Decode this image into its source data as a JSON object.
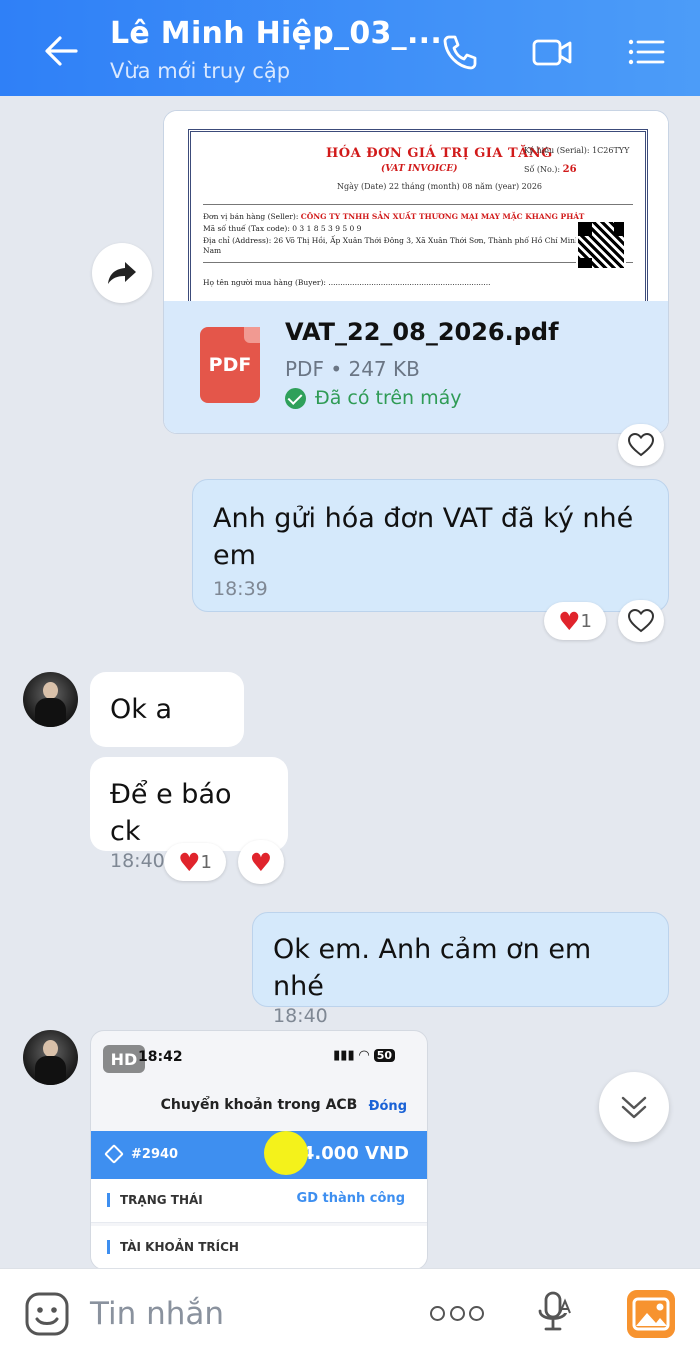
{
  "header": {
    "title": "Lê Minh Hiệp_03_...",
    "subtitle": "Vừa mới truy cập"
  },
  "file_message": {
    "invoice": {
      "title": "HÓA ĐƠN GIÁ TRỊ GIA TĂNG",
      "subtitle": "(VAT INVOICE)",
      "date_line": "Ngày (Date) 22 tháng (month) 08 năm (year) 2026",
      "serial_line": "Ký hiệu (Serial): 1C26TYY",
      "number_label": "Số (No.):",
      "number": "26",
      "seller_label": "Đơn vị bán hàng (Seller):",
      "seller": "CÔNG TY TNHH SẢN XUẤT THƯƠNG MẠI MAY MẶC KHANG PHÁT",
      "tax_line": "Mã số thuế (Tax code): 0 3 1 8 5 3 9 5 0 9",
      "address_line": "Địa chỉ (Address): 26 Võ Thị Hồi, Ấp Xuân Thới Đông 3, Xã Xuân Thới Sơn, Thành phố Hồ Chí Minh, Việt",
      "address_line2": "Nam",
      "buyer_line": "Họ tên người mua hàng (Buyer): ...................................................................."
    },
    "file_icon_label": "PDF",
    "file_name": "VAT_22_08_2026.pdf",
    "file_meta": "PDF • 247 KB",
    "file_status": "Đã có trên máy"
  },
  "messages": [
    {
      "text": "Anh gửi hóa đơn VAT đã ký nhé em",
      "time": "18:39",
      "reaction_count": "1"
    },
    {
      "text": "Ok a"
    },
    {
      "text": "Để e báo ck",
      "time": "18:40",
      "reaction_count": "1"
    },
    {
      "text": "Ok em. Anh cảm ơn em nhé",
      "time": "18:40"
    }
  ],
  "image_message": {
    "hd_badge": "HD",
    "phone_time": "18:42",
    "battery": "50",
    "screen_title": "Chuyển khoản trong ACB",
    "close_label": "Đóng",
    "ref": "#2940",
    "amount": "84.000 VND",
    "status_label": "TRẠNG THÁI",
    "status_value": "GD thành công",
    "account_label": "TÀI KHOẢN TRÍCH"
  },
  "input": {
    "placeholder": "Tin nhắn"
  },
  "colors": {
    "header_gradient_start": "#2f80f7",
    "header_gradient_end": "#4c9cf8",
    "my_bubble": "#d5e9fb",
    "heart": "#e0242c",
    "pdf_icon": "#e4564a",
    "success_green": "#2f9b55"
  }
}
